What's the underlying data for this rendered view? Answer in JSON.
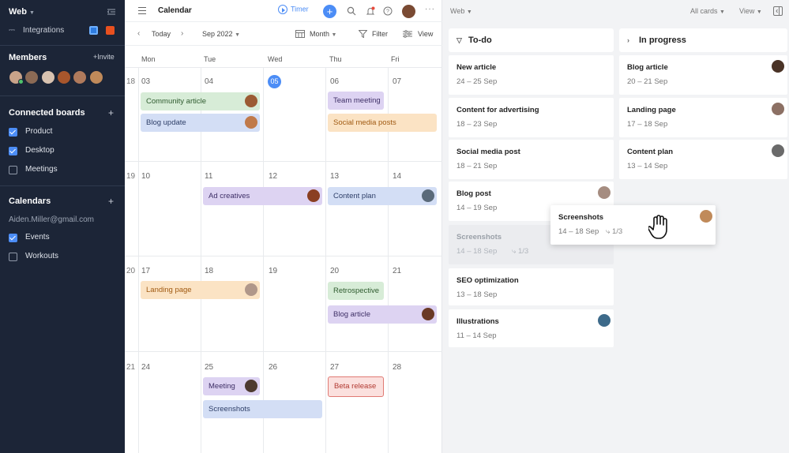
{
  "sidebar": {
    "workspace": "Web",
    "integrations_label": "Integrations",
    "members_title": "Members",
    "invite_label": "+Invite",
    "connected_boards_title": "Connected boards",
    "boards": [
      {
        "label": "Product",
        "checked": true
      },
      {
        "label": "Desktop",
        "checked": true
      },
      {
        "label": "Meetings",
        "checked": false
      }
    ],
    "calendars_title": "Calendars",
    "calendar_email": "Aiden.Miller@gmail.com",
    "calendars": [
      {
        "label": "Events",
        "checked": true
      },
      {
        "label": "Workouts",
        "checked": false
      }
    ],
    "add_icon": "+"
  },
  "calendar": {
    "title": "Calendar",
    "timer_label": "Timer",
    "today_label": "Today",
    "month_label": "Sep 2022",
    "view_mode": "Month",
    "filter_label": "Filter",
    "view_label": "View",
    "days": [
      "Mon",
      "Tue",
      "Wed",
      "Thu",
      "Fri"
    ],
    "weeks": [
      {
        "num": "18",
        "dates": [
          "03",
          "04",
          "05",
          "06",
          "07"
        ]
      },
      {
        "num": "19",
        "dates": [
          "10",
          "11",
          "12",
          "13",
          "14"
        ]
      },
      {
        "num": "20",
        "dates": [
          "17",
          "18",
          "19",
          "20",
          "21"
        ]
      },
      {
        "num": "21",
        "dates": [
          "24",
          "25",
          "26",
          "27",
          "28"
        ]
      }
    ],
    "events": [
      {
        "label": "Community article",
        "color": "green"
      },
      {
        "label": "Blog update",
        "color": "blue"
      },
      {
        "label": "Team meeting",
        "color": "purple"
      },
      {
        "label": "Social media posts",
        "color": "orange"
      },
      {
        "label": "Ad creatives",
        "color": "purple"
      },
      {
        "label": "Content plan",
        "color": "blue"
      },
      {
        "label": "Landing page",
        "color": "orange"
      },
      {
        "label": "Retrospective",
        "color": "green"
      },
      {
        "label": "Blog article",
        "color": "purple"
      },
      {
        "label": "Meeting",
        "color": "purple"
      },
      {
        "label": "Screenshots",
        "color": "blue"
      },
      {
        "label": "Beta release",
        "color": "red"
      }
    ]
  },
  "board": {
    "workspace": "Web",
    "all_cards_label": "All cards",
    "view_label": "View",
    "columns": [
      {
        "title": "To-do",
        "cards": [
          {
            "title": "New article",
            "dates": "24 – 25 Sep"
          },
          {
            "title": "Content for advertising",
            "dates": "18 – 23 Sep"
          },
          {
            "title": "Social media post",
            "dates": "18 – 21 Sep"
          },
          {
            "title": "Blog post",
            "dates": "14 – 19 Sep"
          },
          {
            "title": "Screenshots",
            "dates": "14 – 18 Sep",
            "subtasks": "1/3"
          },
          {
            "title": "SEO optimization",
            "dates": "13 – 18 Sep"
          },
          {
            "title": "Illustrations",
            "dates": "11 – 14 Sep"
          }
        ]
      },
      {
        "title": "In progress",
        "cards": [
          {
            "title": "Blog article",
            "dates": "20 – 21 Sep"
          },
          {
            "title": "Landing page",
            "dates": "17 – 18 Sep"
          },
          {
            "title": "Content plan",
            "dates": "13 – 14 Sep"
          }
        ]
      }
    ],
    "dragging_card": {
      "title": "Screenshots",
      "dates": "14 – 18 Sep",
      "subtasks": "1/3"
    }
  }
}
